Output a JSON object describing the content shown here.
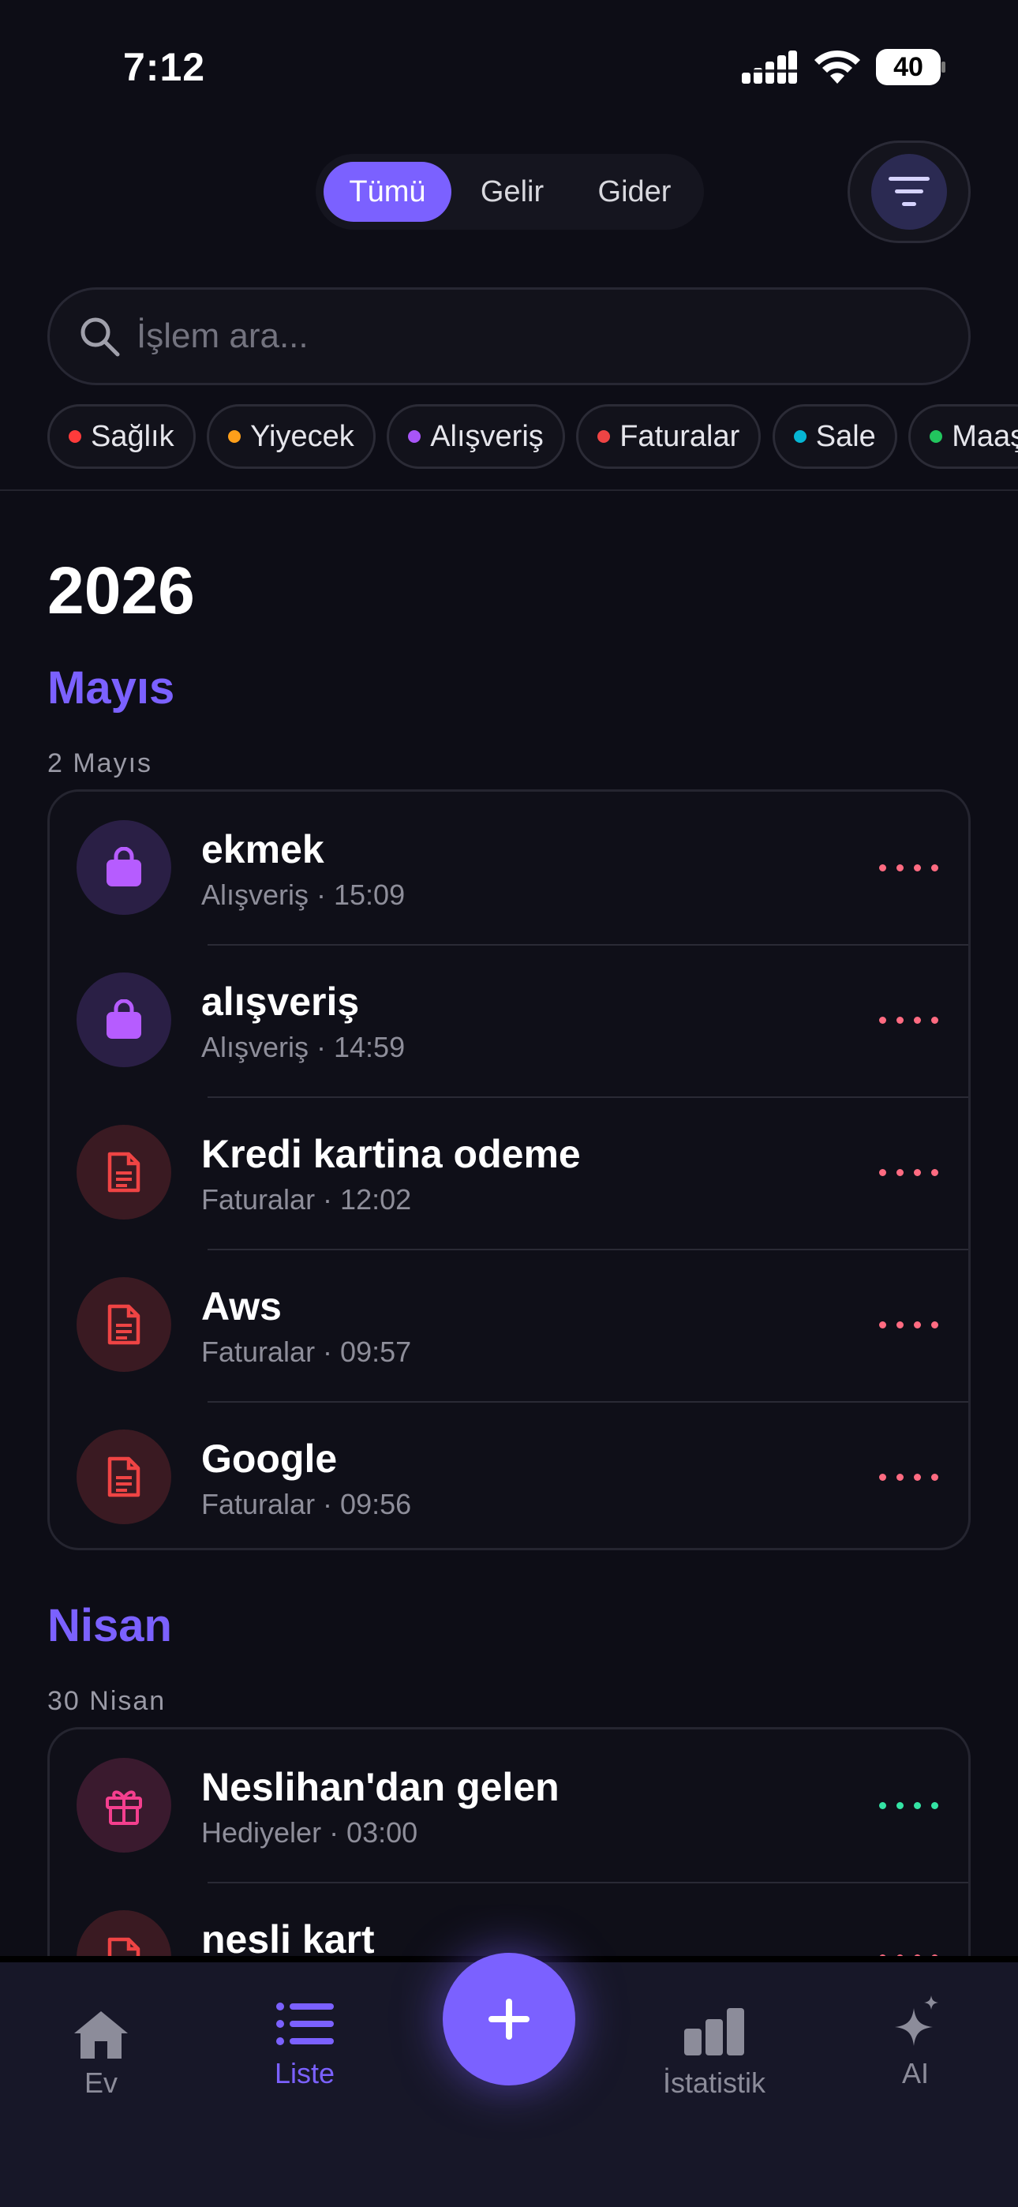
{
  "status_bar": {
    "time": "7:12",
    "battery": "40"
  },
  "segments": {
    "all": "Tümü",
    "income": "Gelir",
    "expense": "Gider"
  },
  "search": {
    "placeholder": "İşlem ara..."
  },
  "chips": [
    {
      "label": "Sağlık",
      "color": "#ff3b3b"
    },
    {
      "label": "Yiyecek",
      "color": "#ff9f1a"
    },
    {
      "label": "Alışveriş",
      "color": "#a855f7"
    },
    {
      "label": "Faturalar",
      "color": "#ef4444"
    },
    {
      "label": "Sale",
      "color": "#06b6d4"
    },
    {
      "label": "Maaş",
      "color": "#22c55e"
    }
  ],
  "year": "2026",
  "groups": [
    {
      "month": "Mayıs",
      "day": "2 Mayıs",
      "items": [
        {
          "title": "ekmek",
          "subtitle": "Alışveriş · 15:09",
          "icon": "shopping-bag-icon"
        },
        {
          "title": "alışveriş",
          "subtitle": "Alışveriş · 14:59",
          "icon": "shopping-bag-icon"
        },
        {
          "title": "Kredi kartina odeme",
          "subtitle": "Faturalar · 12:02",
          "icon": "document-icon"
        },
        {
          "title": "Aws",
          "subtitle": "Faturalar · 09:57",
          "icon": "document-icon"
        },
        {
          "title": "Google",
          "subtitle": "Faturalar · 09:56",
          "icon": "document-icon"
        }
      ]
    },
    {
      "month": "Nisan",
      "day": "30 Nisan",
      "items": [
        {
          "title": "Neslihan'dan gelen",
          "subtitle": "Hediyeler · 03:00",
          "icon": "gift-icon"
        },
        {
          "title": "nesli kart",
          "subtitle": "",
          "icon": "document-icon"
        }
      ]
    }
  ],
  "colors": {
    "accent": "#7b61ff",
    "expense_dots": "#ff6b81",
    "income_dots": "#34e3a4"
  },
  "nav": {
    "home": "Ev",
    "list": "Liste",
    "stats": "İstatistik",
    "ai": "AI"
  }
}
